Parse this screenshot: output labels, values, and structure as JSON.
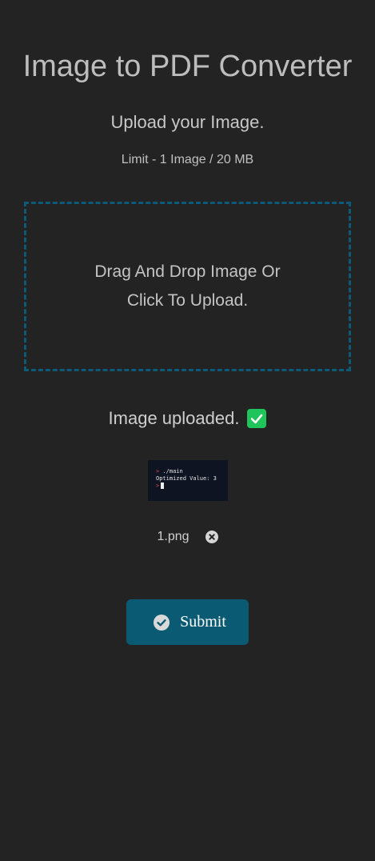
{
  "page": {
    "title": "Image to PDF Converter",
    "subtitle": "Upload your Image.",
    "limit": "Limit - 1 Image / 20 MB"
  },
  "dropzone": {
    "line1": "Drag And Drop Image Or",
    "line2": "Click To Upload."
  },
  "upload_status": {
    "text": "Image uploaded.",
    "icon": "check-square-icon",
    "color": "#1fc45a"
  },
  "preview": {
    "lines": [
      {
        "prompt": ">",
        "text": " ./main"
      },
      {
        "prompt": "",
        "text": "Optimized Value: 3"
      },
      {
        "prompt": ">",
        "text": ""
      }
    ]
  },
  "file": {
    "name": "1.png",
    "remove_icon": "close-circle-icon"
  },
  "submit": {
    "label": "Submit",
    "icon": "check-circle-icon",
    "color": "#0b5a73"
  },
  "colors": {
    "background": "#232323",
    "dropzone_border": "#0d5a78"
  }
}
